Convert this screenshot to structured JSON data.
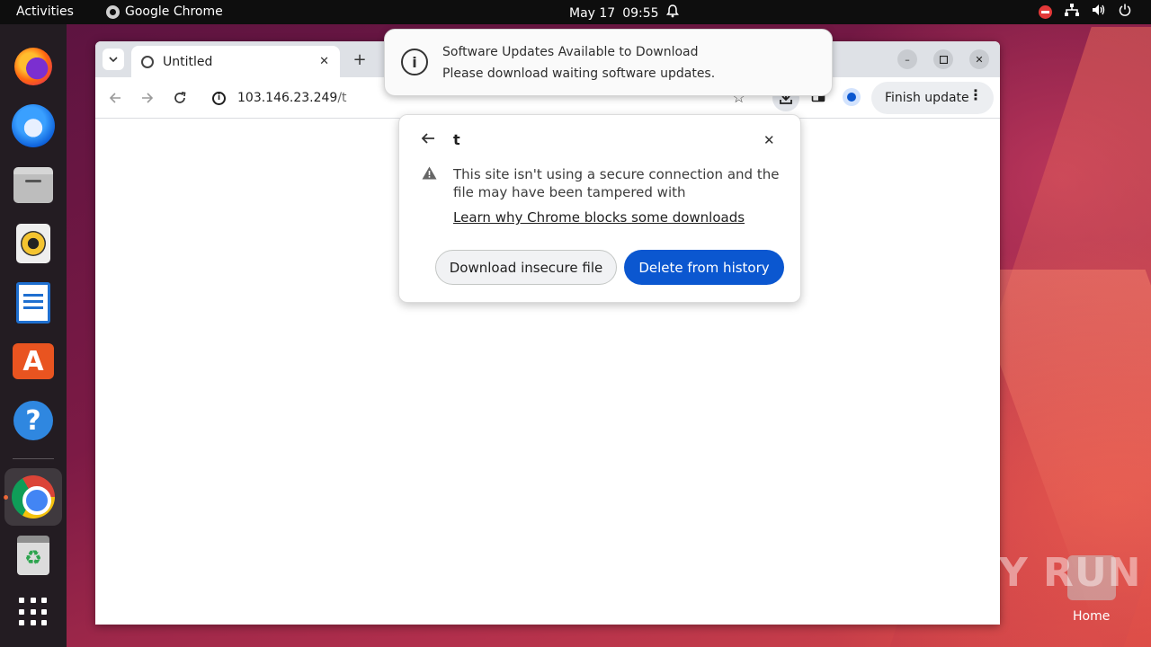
{
  "topbar": {
    "activities": "Activities",
    "app_name": "Google Chrome",
    "date": "May 17",
    "time": "09:55"
  },
  "dock": {
    "items": [
      "firefox",
      "thunderbird",
      "files",
      "rhythmbox",
      "libreoffice-writer",
      "app-center",
      "help",
      "google-chrome",
      "trash",
      "show-apps"
    ]
  },
  "browser": {
    "tab_title": "Untitled",
    "url_host": "103.146.23.249",
    "url_path": "/t",
    "finish_update": "Finish update"
  },
  "notification": {
    "title": "Software Updates Available to Download",
    "body": "Please download waiting software updates."
  },
  "download_bubble": {
    "filename": "t",
    "message": "This site isn't using a secure connection and the file may have been tampered with",
    "learn_link": "Learn why Chrome blocks some downloads",
    "download_button": "Download insecure file",
    "delete_button": "Delete from history"
  },
  "desktop": {
    "watermark": "ANY RUN",
    "home_label": "Home"
  },
  "colors": {
    "accent": "#0b57d0",
    "ubuntu_orange": "#e95420",
    "topbar": "#0e0e0e"
  }
}
